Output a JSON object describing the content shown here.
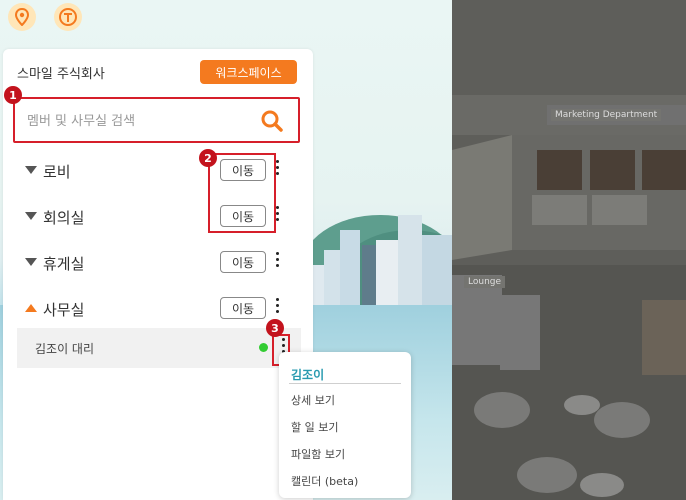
{
  "top_icons": [
    {
      "icon": "location-pin-icon"
    },
    {
      "icon": "t-coin-icon"
    }
  ],
  "office_sign": "Marketing Department",
  "lounge_sign": "Lounge",
  "panel": {
    "company_name": "스마일 주식회사",
    "workspace_button": "워크스페이스",
    "search_placeholder": "멤버 및 사무실 검색",
    "rooms": [
      {
        "name": "로비",
        "move": "이동",
        "expanded": false
      },
      {
        "name": "회의실",
        "move": "이동",
        "expanded": false
      },
      {
        "name": "휴게실",
        "move": "이동",
        "expanded": false
      },
      {
        "name": "사무실",
        "move": "이동",
        "expanded": true
      }
    ],
    "member": {
      "name": "김조이 대리",
      "status_color": "#33cc33"
    }
  },
  "callouts": [
    "1",
    "2",
    "3"
  ],
  "context_menu": {
    "title": "김조이",
    "items": [
      "상세 보기",
      "할 일 보기",
      "파일함 보기",
      "캘린더 (beta)"
    ]
  },
  "colors": {
    "accent": "#f47a1f",
    "callout": "#d61f2a",
    "menu_title": "#2a9bb0"
  }
}
